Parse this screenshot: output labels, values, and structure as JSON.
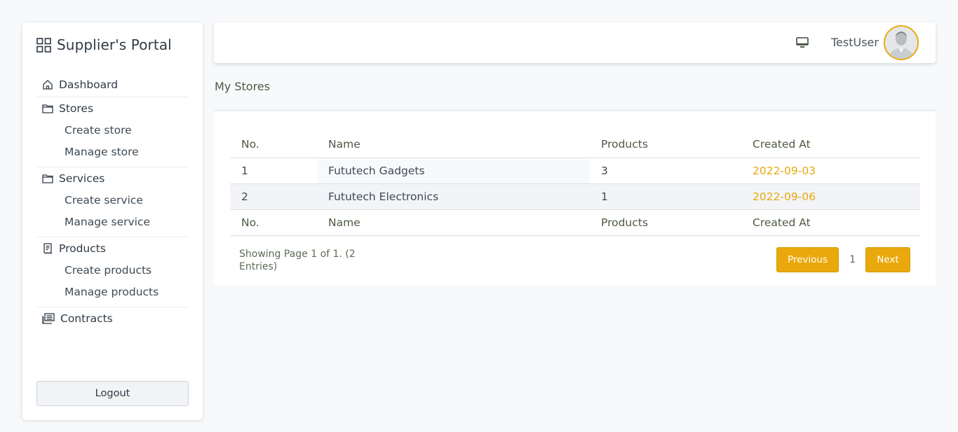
{
  "sidebar": {
    "brand_icon": "grid-icon",
    "title": "Supplier's Portal",
    "dashboard": "Dashboard",
    "stores": "Stores",
    "create_store": "Create store",
    "manage_store": "Manage store",
    "services": "Services",
    "create_service": "Create service",
    "manage_service": "Manage service",
    "products": "Products",
    "create_products": "Create products",
    "manage_products": "Manage products",
    "contracts": "Contracts",
    "logout": "Logout"
  },
  "topbar": {
    "username": "TestUser",
    "icons": [
      "monitor-icon",
      "avatar"
    ]
  },
  "page": {
    "title": "My Stores"
  },
  "table": {
    "headers": [
      "No.",
      "Name",
      "Products",
      "Created At"
    ],
    "rows": [
      {
        "no": "1",
        "name": "Fututech Gadgets",
        "products": "3",
        "created_at": "2022-09-03"
      },
      {
        "no": "2",
        "name": "Fututech Electronics",
        "products": "1",
        "created_at": "2022-09-06"
      }
    ]
  },
  "pagination": {
    "showing": "Showing Page 1 of 1. (2 Entries)",
    "previous": "Previous",
    "page": "1",
    "next": "Next"
  },
  "colors": {
    "accent": "#e9a80c",
    "text": "#3d4a3a",
    "background": "#f8f9fb"
  }
}
